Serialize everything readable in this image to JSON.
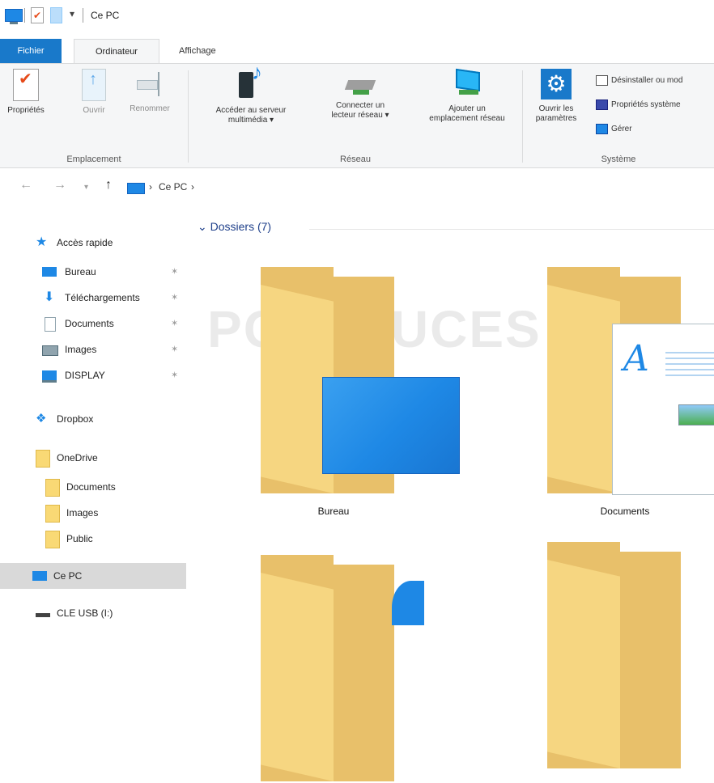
{
  "window": {
    "title": "Ce PC"
  },
  "tabs": {
    "file": "Fichier",
    "computer": "Ordinateur",
    "view": "Affichage"
  },
  "ribbon": {
    "location": {
      "label": "Emplacement",
      "properties": "Propriétés",
      "open": "Ouvrir",
      "rename": "Renommer"
    },
    "network": {
      "label": "Réseau",
      "media_line1": "Accéder au serveur",
      "media_line2": "multimédia ▾",
      "map_line1": "Connecter un",
      "map_line2": "lecteur réseau ▾",
      "add_line1": "Ajouter un",
      "add_line2": "emplacement réseau"
    },
    "system": {
      "label": "Système",
      "settings_line1": "Ouvrir les",
      "settings_line2": "paramètres",
      "uninstall": "Désinstaller ou mod",
      "sys_props": "Propriétés système",
      "manage": "Gérer"
    }
  },
  "address": {
    "separator": "›",
    "current": "Ce PC"
  },
  "sidebar": {
    "quick_access": "Accès rapide",
    "items": [
      {
        "label": "Bureau",
        "icon": "desktop-icon",
        "pinned": true
      },
      {
        "label": "Téléchargements",
        "icon": "download-icon",
        "pinned": true
      },
      {
        "label": "Documents",
        "icon": "documents-icon",
        "pinned": true
      },
      {
        "label": "Images",
        "icon": "images-icon",
        "pinned": true
      },
      {
        "label": "DISPLAY",
        "icon": "display-icon",
        "pinned": true
      }
    ],
    "dropbox": "Dropbox",
    "onedrive": "OneDrive",
    "onedrive_items": [
      "Documents",
      "Images",
      "Public"
    ],
    "this_pc": "Ce PC",
    "usb": "CLE USB (I:)",
    "pin_glyph": "✶"
  },
  "content": {
    "group_header": "Dossiers (7)",
    "folders": [
      {
        "name": "Bureau"
      },
      {
        "name": "Documents"
      }
    ],
    "watermark": "PCASTUCES"
  }
}
